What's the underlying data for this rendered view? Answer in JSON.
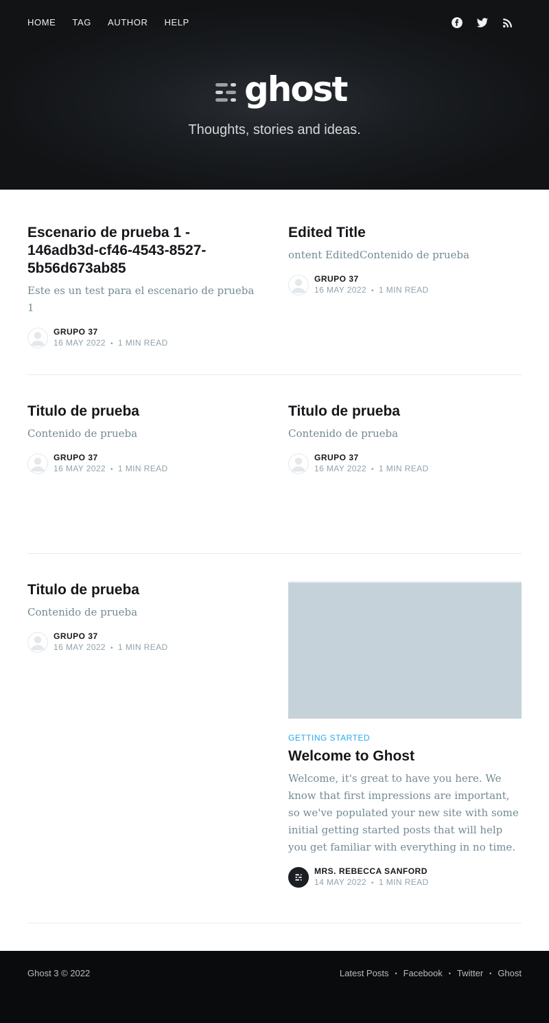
{
  "nav": {
    "items": [
      "HOME",
      "TAG",
      "AUTHOR",
      "HELP"
    ]
  },
  "social": [
    "facebook-icon",
    "twitter-icon",
    "rss-icon"
  ],
  "brand": {
    "logo_text": "ghost",
    "tagline": "Thoughts, stories and ideas."
  },
  "posts": [
    {
      "title": "Escenario de prueba 1 - 146adb3d-cf46-4543-8527-5b56d673ab85",
      "excerpt": "Este es un test para el escenario de prueba 1",
      "author": "GRUPO 37",
      "date": "16 MAY 2022",
      "read": "1 MIN READ"
    },
    {
      "title": "Edited Title",
      "excerpt": "ontent EditedContenido de prueba",
      "author": "GRUPO 37",
      "date": "16 MAY 2022",
      "read": "1 MIN READ"
    },
    {
      "title": "Titulo de prueba",
      "excerpt": "Contenido de prueba",
      "author": "GRUPO 37",
      "date": "16 MAY 2022",
      "read": "1 MIN READ"
    },
    {
      "title": "Titulo de prueba",
      "excerpt": "Contenido de prueba",
      "author": "GRUPO 37",
      "date": "16 MAY 2022",
      "read": "1 MIN READ"
    },
    {
      "title": "Titulo de prueba",
      "excerpt": "Contenido de prueba",
      "author": "GRUPO 37",
      "date": "16 MAY 2022",
      "read": "1 MIN READ"
    },
    {
      "tag": "GETTING STARTED",
      "title": "Welcome to Ghost",
      "excerpt": "Welcome, it's great to have you here. We know that first impressions are important, so we've populated your new site with some initial getting started posts that will help you get familiar with everything in no time.",
      "author": "MRS. REBECCA SANFORD",
      "date": "14 MAY 2022",
      "read": "1 MIN READ"
    }
  ],
  "footer": {
    "copyright": "Ghost 3 © 2022",
    "links": [
      "Latest Posts",
      "Facebook",
      "Twitter",
      "Ghost"
    ],
    "separator": "•"
  },
  "meta_separator": "•",
  "colors": {
    "header_bg": "#111315",
    "accent_tag": "#26a8ed",
    "excerpt": "#738a94",
    "feature_image_placeholder": "#c5d2d9",
    "footer_bg": "#0a0b0c"
  }
}
